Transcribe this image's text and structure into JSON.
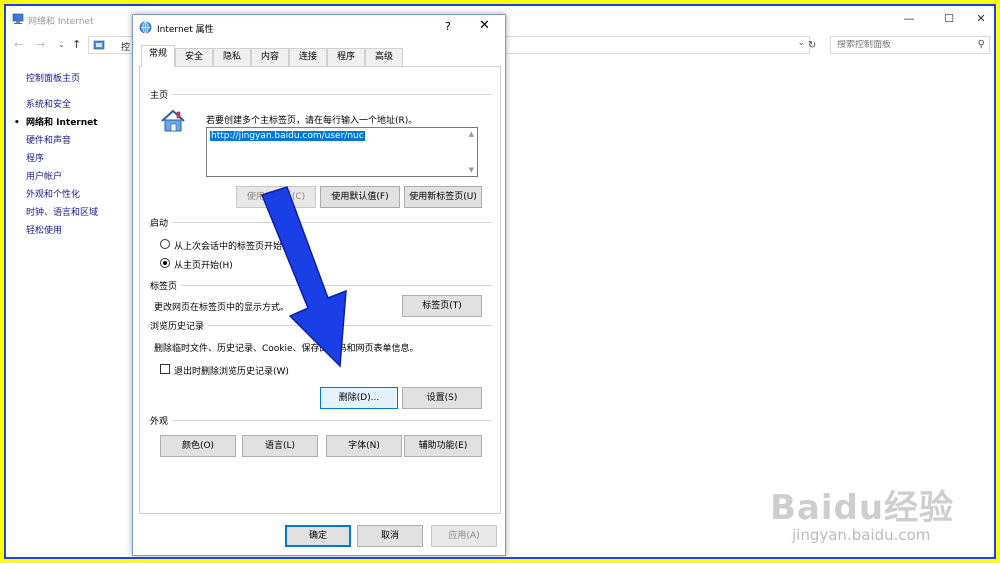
{
  "control_panel": {
    "title": "网络和 Internet",
    "window_controls": {
      "minimize": "—",
      "maximize": "☐",
      "close": "✕"
    },
    "nav": {
      "back": "←",
      "forward": "→",
      "recent": "⌄",
      "up": "↑"
    },
    "address_text": "控",
    "address_dropdown": "⌄",
    "refresh": "↻",
    "search_placeholder": "搜索控制面板",
    "search_icon": "⚲",
    "sidebar": {
      "home": "控制面板主页",
      "items": [
        {
          "label": "系统和安全"
        },
        {
          "label": "网络和 Internet",
          "active": true
        },
        {
          "label": "硬件和声音"
        },
        {
          "label": "程序"
        },
        {
          "label": "用户帐户"
        },
        {
          "label": "外观和个性化"
        },
        {
          "label": "时钟、语言和区域"
        },
        {
          "label": "轻松使用"
        }
      ]
    }
  },
  "dialog": {
    "title": "Internet 属性",
    "help": "?",
    "close": "✕",
    "tabs": [
      "常规",
      "安全",
      "隐私",
      "内容",
      "连接",
      "程序",
      "高级"
    ],
    "selected_tab": "常规",
    "home": {
      "label": "主页",
      "instruction": "若要创建多个主标签页，请在每行输入一个地址(R)。",
      "url": "http://jingyan.baidu.com/user/nuc",
      "scroll_up": "▲",
      "scroll_down": "▼",
      "btn_use_current": "使用当前页(C)",
      "btn_use_default": "使用默认值(F)",
      "btn_use_new_tab": "使用新标签页(U)"
    },
    "startup": {
      "label": "启动",
      "option_last_session": "从上次会话中的标签页开始(B)",
      "option_home": "从主页开始(H)",
      "selected": "option_home"
    },
    "tabs_section": {
      "label": "标签页",
      "description": "更改网页在标签页中的显示方式。",
      "btn_tabs": "标签页(T)"
    },
    "history": {
      "label": "浏览历史记录",
      "description": "删除临时文件、历史记录、Cookie、保存的密码和网页表单信息。",
      "checkbox_label": "退出时删除浏览历史记录(W)",
      "checkbox_checked": false,
      "btn_delete": "删除(D)...",
      "btn_settings": "设置(S)"
    },
    "appearance": {
      "label": "外观",
      "btn_colors": "颜色(O)",
      "btn_languages": "语言(L)",
      "btn_fonts": "字体(N)",
      "btn_accessibility": "辅助功能(E)"
    },
    "footer": {
      "ok": "确定",
      "cancel": "取消",
      "apply": "应用(A)"
    }
  },
  "watermark": {
    "brand": "Baidu经验",
    "url": "jingyan.baidu.com"
  },
  "colors": {
    "frame_yellow": "#ffff00",
    "frame_blue": "#1e3ef0",
    "arrow_blue": "#1a3fe6",
    "selection_blue": "#0078d7"
  }
}
